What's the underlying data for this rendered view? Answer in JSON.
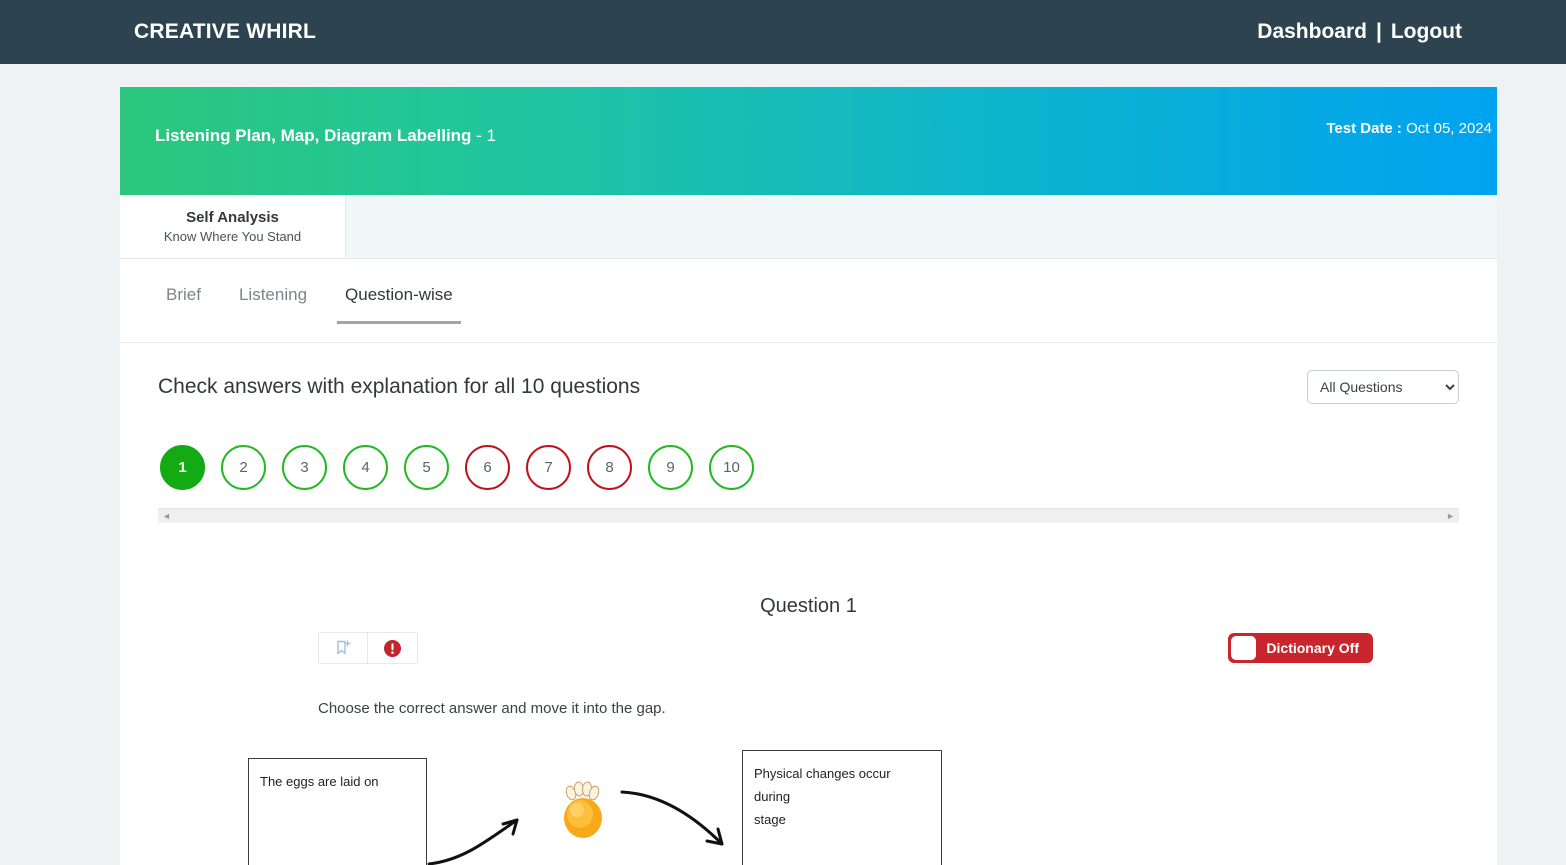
{
  "navbar": {
    "brand": "CREATIVE WHIRL",
    "dashboard_label": "Dashboard",
    "separator": "|",
    "logout_label": "Logout"
  },
  "banner": {
    "title": "Listening Plan, Map, Diagram Labelling",
    "title_suffix": "- 1",
    "date_label": "Test Date :",
    "date_value": "Oct 05, 2024",
    "gradient_from": "#2bc77d",
    "gradient_to": "#00a3f0"
  },
  "analysis": {
    "title": "Self Analysis",
    "subtitle": "Know Where You Stand"
  },
  "tabs": [
    {
      "label": "Brief",
      "active": false
    },
    {
      "label": "Listening",
      "active": false
    },
    {
      "label": "Question-wise",
      "active": true
    }
  ],
  "main": {
    "heading": "Check answers with explanation for all 10 questions",
    "filter_selected": "All Questions",
    "filter_options": [
      "All Questions"
    ]
  },
  "question_nav": {
    "items": [
      {
        "number": "1",
        "state": "active"
      },
      {
        "number": "2",
        "state": "correct"
      },
      {
        "number": "3",
        "state": "correct"
      },
      {
        "number": "4",
        "state": "correct"
      },
      {
        "number": "5",
        "state": "correct"
      },
      {
        "number": "6",
        "state": "wrong"
      },
      {
        "number": "7",
        "state": "wrong"
      },
      {
        "number": "8",
        "state": "wrong"
      },
      {
        "number": "9",
        "state": "correct"
      },
      {
        "number": "10",
        "state": "correct"
      }
    ],
    "correct_color": "#22b922",
    "wrong_color": "#c0121c",
    "active_color": "#13aa13"
  },
  "scrollbar": {
    "left_arrow": "◄",
    "right_arrow": "►"
  },
  "question": {
    "title": "Question 1",
    "instruction": "Choose the correct answer and move it into the gap.",
    "tools": [
      {
        "name": "bookmark-add-icon"
      },
      {
        "name": "report-issue-icon"
      }
    ],
    "dictionary_toggle": {
      "label": "Dictionary Off",
      "state": "off",
      "color": "#c8262c"
    },
    "diagram": {
      "left_box_text": "The eggs are laid on",
      "right_box_lines": [
        "Physical changes occur",
        "during",
        "stage"
      ],
      "center_image": "egg-larva-illustration"
    }
  }
}
